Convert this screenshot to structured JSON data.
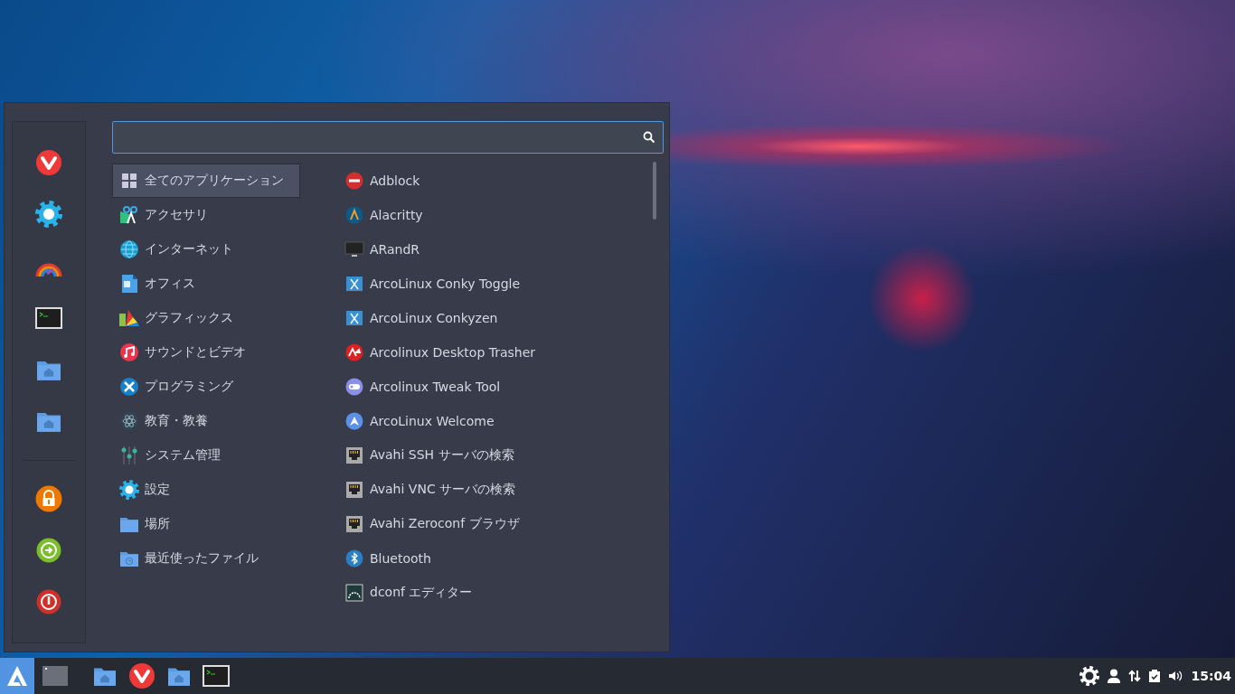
{
  "menu": {
    "categories": [
      {
        "label": "全てのアプリケーション",
        "selected": true
      },
      {
        "label": "アクセサリ",
        "selected": false
      },
      {
        "label": "インターネット",
        "selected": false
      },
      {
        "label": "オフィス",
        "selected": false
      },
      {
        "label": "グラフィックス",
        "selected": false
      },
      {
        "label": "サウンドとビデオ",
        "selected": false
      },
      {
        "label": "プログラミング",
        "selected": false
      },
      {
        "label": "教育・教養",
        "selected": false
      },
      {
        "label": "システム管理",
        "selected": false
      },
      {
        "label": "設定",
        "selected": false
      },
      {
        "label": "場所",
        "selected": false
      },
      {
        "label": "最近使ったファイル",
        "selected": false
      }
    ],
    "apps": [
      "Adblock",
      "Alacritty",
      "ARandR",
      "ArcoLinux Conky Toggle",
      "ArcoLinux Conkyzen",
      "Arcolinux Desktop Trasher",
      "Arcolinux Tweak Tool",
      "ArcoLinux Welcome",
      "Avahi SSH サーバの検索",
      "Avahi VNC サーバの検索",
      "Avahi Zeroconf ブラウザ",
      "Bluetooth",
      "dconf エディター"
    ]
  },
  "taskbar": {
    "clock": "15:04"
  }
}
